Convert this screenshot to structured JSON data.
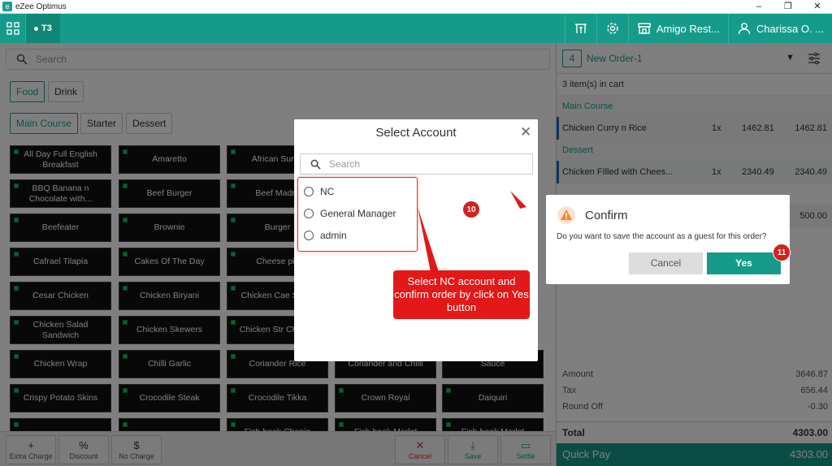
{
  "window": {
    "title": "eZee Optimus",
    "minimize": "–",
    "maximize": "❐",
    "close": "✕"
  },
  "topbar": {
    "table_tab": "T3",
    "restaurant": "Amigo Rest...",
    "user": "Charissa O. ..."
  },
  "left": {
    "search_placeholder": "Search",
    "menu_tabs": [
      "Food",
      "Drink"
    ],
    "sub_tabs": [
      "Main Course",
      "Starter",
      "Dessert"
    ],
    "items": [
      [
        "All Day Full English Breakfast",
        "Amaretto",
        "African Surf n",
        "",
        ""
      ],
      [
        "BBQ Banana n Chocolate with...",
        "Beef Burger",
        "Beef Madra",
        "",
        ""
      ],
      [
        "Beefeater",
        "Brownie",
        "Burger",
        "",
        ""
      ],
      [
        "Cafrael Tilapia",
        "Cakes Of The Day",
        "Cheese piz",
        "",
        ""
      ],
      [
        "Cesar Chicken",
        "Chicken Biryani",
        "Chicken Cae Salad",
        "",
        ""
      ],
      [
        "Chicken Salad Sandwich",
        "Chicken Skewers",
        "Chicken Str Cheese",
        "",
        ""
      ],
      [
        "Chicken Wrap",
        "Chilli Garlic",
        "Coriander Rice",
        "Coriander and Chilli",
        "Sauce"
      ],
      [
        "Crispy Potato Skins",
        "Crocodile Steak",
        "Crocodile Tikka",
        "Crown Royal",
        "Daiquiri"
      ],
      [
        "",
        "",
        "Fish hook Chopin",
        "Fish hook Merlot",
        "Fish hook Merlot"
      ]
    ],
    "bottom_buttons": {
      "extra_charge": {
        "icon": "+",
        "label": "Extra Charge"
      },
      "discount": {
        "icon": "%",
        "label": "Discount"
      },
      "no_charge": {
        "icon": "$",
        "label": "No Charge"
      },
      "cancel": {
        "icon": "✕",
        "label": "Cancel"
      },
      "save": {
        "icon": "⤓",
        "label": "Save"
      },
      "settle": {
        "icon": "▭",
        "label": "Settle"
      }
    }
  },
  "order": {
    "number": "4",
    "name": "New Order-1",
    "cart_count": "3 item(s) in cart",
    "sections": [
      {
        "category": "Main Course",
        "item": "Chicken Curry n Rice",
        "qty": "1x",
        "rate": "1462.81",
        "amount": "1462.81"
      },
      {
        "category": "Dessert",
        "item": "Chicken FIlled with Chees...",
        "qty": "1x",
        "rate": "2340.49",
        "amount": "2340.49"
      }
    ],
    "third_amount": "500.00",
    "totals": [
      {
        "label": "Amount",
        "value": "3646.87"
      },
      {
        "label": "Tax",
        "value": "656.44"
      },
      {
        "label": "Round Off",
        "value": "-0.30"
      }
    ],
    "total_label": "Total",
    "total_value": "4303.00",
    "quickpay_label": "Quick Pay",
    "quickpay_value": "4303.00"
  },
  "select_account": {
    "title": "Select Account",
    "close": "✕",
    "search_placeholder": "Search",
    "options": [
      "NC",
      "General Manager",
      "admin"
    ]
  },
  "confirm": {
    "title": "Confirm",
    "message": "Do you want to save the account as a guest for this order?",
    "cancel": "Cancel",
    "yes": "Yes"
  },
  "callout": {
    "text": "Select NC account and confirm order by click on Yes button",
    "step_a": "10",
    "step_b": "11"
  },
  "colors": {
    "accent": "#169b8b",
    "callout": "#e31818",
    "item_bg": "#111111"
  }
}
